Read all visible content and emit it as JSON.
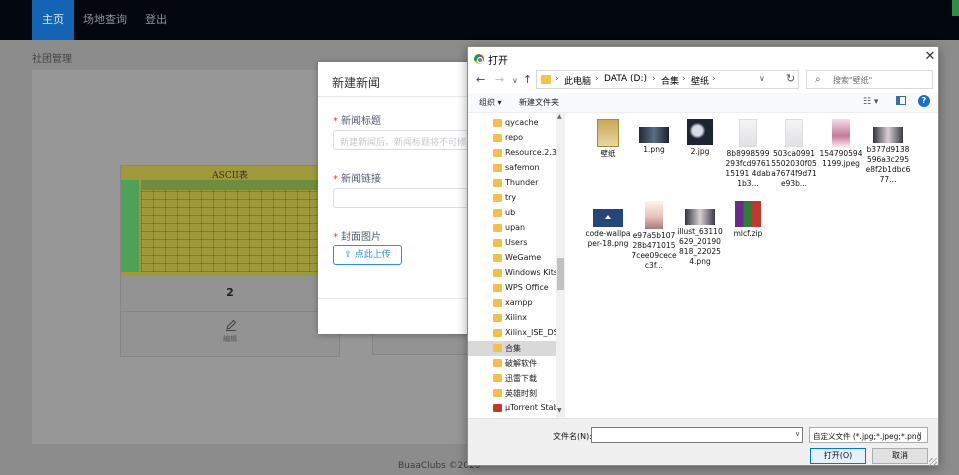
{
  "nav": {
    "home": "主页",
    "venue": "场地查询",
    "logout": "登出"
  },
  "breadcrumb": "社团管理",
  "card": {
    "ascii_title": "ASCII表",
    "number": "2",
    "edit_label": "编辑"
  },
  "footer": "BuaaClubs ©2020",
  "modal": {
    "title": "新建新闻",
    "title_label": "新闻标题",
    "title_placeholder": "新建新闻后，新闻标题将不可修改",
    "link_label": "新闻链接",
    "cover_label": "封面图片",
    "upload_button": "点此上传",
    "required_mark": "*"
  },
  "dialog": {
    "title": "打开",
    "close": "✕",
    "address": {
      "segments": [
        "此电脑",
        "DATA (D:)",
        "合集",
        "壁纸"
      ]
    },
    "search_placeholder": "搜索\"壁纸\"",
    "toolbar": {
      "organize": "组织 ▾",
      "new_folder": "新建文件夹",
      "help": "?"
    },
    "tree": [
      {
        "label": "qycache",
        "selected": false
      },
      {
        "label": "repo",
        "selected": false
      },
      {
        "label": "Resource.2.3.",
        "selected": false
      },
      {
        "label": "safemon",
        "selected": false
      },
      {
        "label": "Thunder",
        "selected": false
      },
      {
        "label": "try",
        "selected": false
      },
      {
        "label": "ub",
        "selected": false
      },
      {
        "label": "upan",
        "selected": false
      },
      {
        "label": "Users",
        "selected": false
      },
      {
        "label": "WeGame",
        "selected": false
      },
      {
        "label": "Windows Kits",
        "selected": false
      },
      {
        "label": "WPS Office",
        "selected": false
      },
      {
        "label": "xampp",
        "selected": false
      },
      {
        "label": "Xilinx",
        "selected": false
      },
      {
        "label": "Xilinx_ISE_DS_",
        "selected": false
      },
      {
        "label": "合集",
        "selected": true
      },
      {
        "label": "破解软件",
        "selected": false
      },
      {
        "label": "迅雷下载",
        "selected": false
      },
      {
        "label": "英雄时刻",
        "selected": false
      },
      {
        "label": "µTorrent Stab",
        "selected": false
      }
    ],
    "files": [
      {
        "name": "壁纸",
        "icon": "folder-icon"
      },
      {
        "name": "1.png",
        "icon": "image-icon"
      },
      {
        "name": "2.jpg",
        "icon": "image-icon"
      },
      {
        "name": "8b8998599293fcd976115191 4dab1b3...",
        "icon": "image-icon"
      },
      {
        "name": "503ca09915502030f05a7674f9d71e93b...",
        "icon": "image-icon"
      },
      {
        "name": "1547905941199.jpeg",
        "icon": "image-icon"
      },
      {
        "name": "b377d9138596a3c295e8f2b1dbc677...",
        "icon": "image-icon"
      },
      {
        "name": "code-wallpaper-18.png",
        "icon": "image-icon"
      },
      {
        "name": "e97a5b10728b4710157cee09cecec3f...",
        "icon": "image-icon"
      },
      {
        "name": "illust_63110629_20190818_220254.png",
        "icon": "image-icon"
      },
      {
        "name": "mlcf.zip",
        "icon": "archive-icon"
      }
    ],
    "filename_label": "文件名(N):",
    "filename_value": "",
    "filetype": "自定义文件 (*.jpg;*.jpeg;*.png",
    "open_button": "打开(O)",
    "cancel_button": "取消"
  }
}
